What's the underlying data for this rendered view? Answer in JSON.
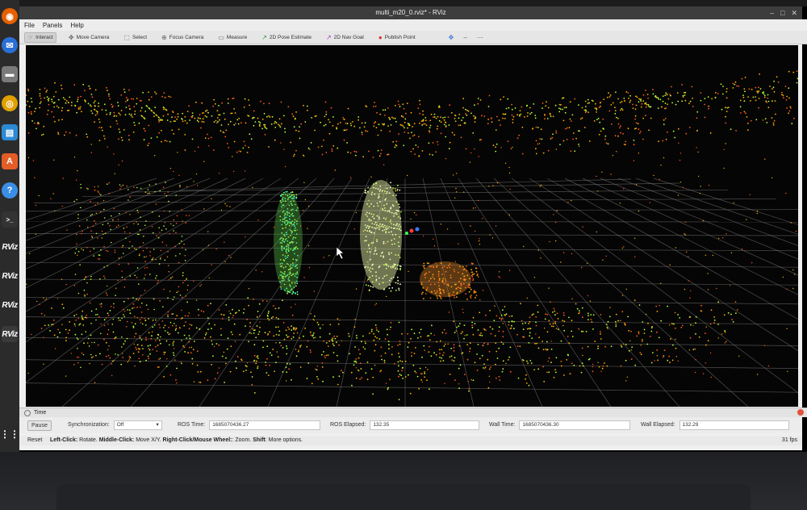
{
  "top_bar": {
    "clock": ""
  },
  "dock": {
    "items": [
      {
        "name": "firefox",
        "glyph": "◉",
        "color": "#e66000"
      },
      {
        "name": "thunderbird",
        "glyph": "✉",
        "color": "#2a6fd6"
      },
      {
        "name": "files",
        "glyph": "▬",
        "color": "#6f6f6f"
      },
      {
        "name": "rhythmbox",
        "glyph": "◎",
        "color": "#e0a000"
      },
      {
        "name": "writer",
        "glyph": "▤",
        "color": "#2a8ad6"
      },
      {
        "name": "software",
        "glyph": "A",
        "color": "#e35d27"
      },
      {
        "name": "help",
        "glyph": "?",
        "color": "#3b8ee5"
      },
      {
        "name": "terminal",
        "glyph": ">_",
        "color": "#333333"
      }
    ],
    "rviz_labels": [
      "RViz",
      "RViz",
      "RViz",
      "RViz"
    ],
    "apps_grid": "⋮⋮"
  },
  "window": {
    "title": "multi_m20_0.rviz* - RViz",
    "controls": [
      "–",
      "□",
      "✕"
    ]
  },
  "menu": [
    "File",
    "Panels",
    "Help"
  ],
  "toolbar": {
    "tools": [
      {
        "label": "Interact",
        "icon": "interact-icon",
        "glyph": "☞",
        "active": true
      },
      {
        "label": "Move Camera",
        "icon": "move-camera-icon",
        "glyph": "✥",
        "active": false
      },
      {
        "label": "Select",
        "icon": "select-icon",
        "glyph": "⬚",
        "active": false
      },
      {
        "label": "Focus Camera",
        "icon": "focus-camera-icon",
        "glyph": "⊕",
        "active": false
      },
      {
        "label": "Measure",
        "icon": "measure-icon",
        "glyph": "▭",
        "active": false
      },
      {
        "label": "2D Pose Estimate",
        "icon": "pose-estimate-icon",
        "glyph": "↗",
        "active": false
      },
      {
        "label": "2D Nav Goal",
        "icon": "nav-goal-icon",
        "glyph": "↗",
        "active": false
      },
      {
        "label": "Publish Point",
        "icon": "publish-point-icon",
        "glyph": "📍",
        "active": false
      }
    ],
    "extra_icons": [
      "✥",
      "–",
      "⋯"
    ]
  },
  "time_panel": {
    "title": "Time",
    "pause_label": "Pause",
    "sync_label": "Synchronization:",
    "sync_value": "Off",
    "ros_time_label": "ROS Time:",
    "ros_time_value": "1685070436.27",
    "ros_elapsed_label": "ROS Elapsed:",
    "ros_elapsed_value": "132.35",
    "wall_time_label": "Wall Time:",
    "wall_time_value": "1685070436.30",
    "wall_elapsed_label": "Wall Elapsed:",
    "wall_elapsed_value": "132.29"
  },
  "status_bar": {
    "reset": "Reset",
    "hint_parts": [
      {
        "bold": "Left-Click:",
        "text": " Rotate. "
      },
      {
        "bold": "Middle-Click:",
        "text": " Move X/Y. "
      },
      {
        "bold": "Right-Click/Mouse Wheel:",
        "text": ": Zoom. "
      },
      {
        "bold": "Shift",
        "text": ": More options."
      }
    ],
    "fps": "31 fps"
  },
  "colors": {
    "grid": "#8a8a8a",
    "points_hot": "#ff5a1f",
    "points_warm": "#ffb000",
    "points_cool": "#b8ff3a",
    "points_cyan": "#3affc8"
  }
}
